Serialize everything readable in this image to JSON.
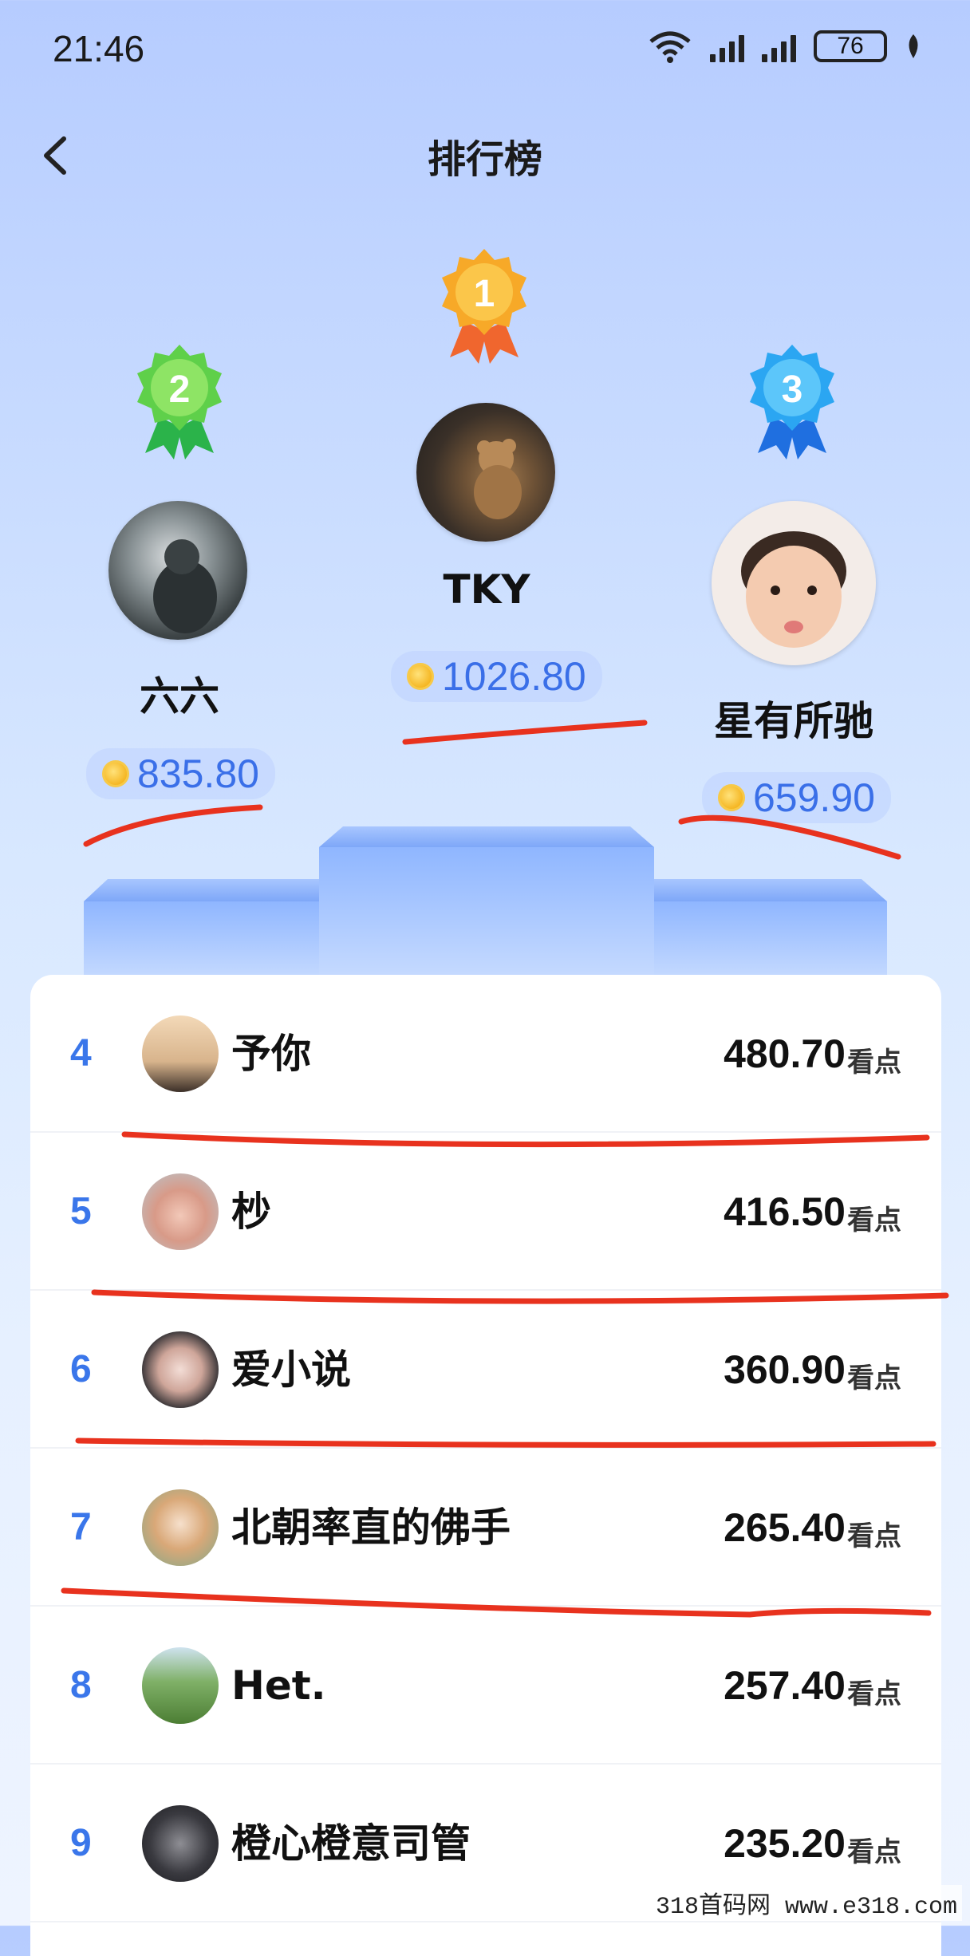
{
  "status_bar": {
    "time": "21:46",
    "battery": "76"
  },
  "header": {
    "title": "排行榜"
  },
  "podium": [
    {
      "rank": "1",
      "name": "TKY",
      "score": "1026.80",
      "medal_color": "#f5a623"
    },
    {
      "rank": "2",
      "name": "六六",
      "score": "835.80",
      "medal_color": "#3fc64a"
    },
    {
      "rank": "3",
      "name": "星有所驰",
      "score": "659.90",
      "medal_color": "#2d8ff0"
    }
  ],
  "list": [
    {
      "rank": "4",
      "name": "予你",
      "score": "480.70",
      "unit": "看点"
    },
    {
      "rank": "5",
      "name": "杪",
      "score": "416.50",
      "unit": "看点"
    },
    {
      "rank": "6",
      "name": "爱小说",
      "score": "360.90",
      "unit": "看点"
    },
    {
      "rank": "7",
      "name": "北朝率直的佛手",
      "score": "265.40",
      "unit": "看点"
    },
    {
      "rank": "8",
      "name": "Het.",
      "score": "257.40",
      "unit": "看点"
    },
    {
      "rank": "9",
      "name": "橙心橙意司管",
      "score": "235.20",
      "unit": "看点"
    }
  ],
  "watermark": "318首码网 www.e318.com",
  "colors": {
    "accent": "#3a76ea",
    "annotation": "#e8321e"
  }
}
